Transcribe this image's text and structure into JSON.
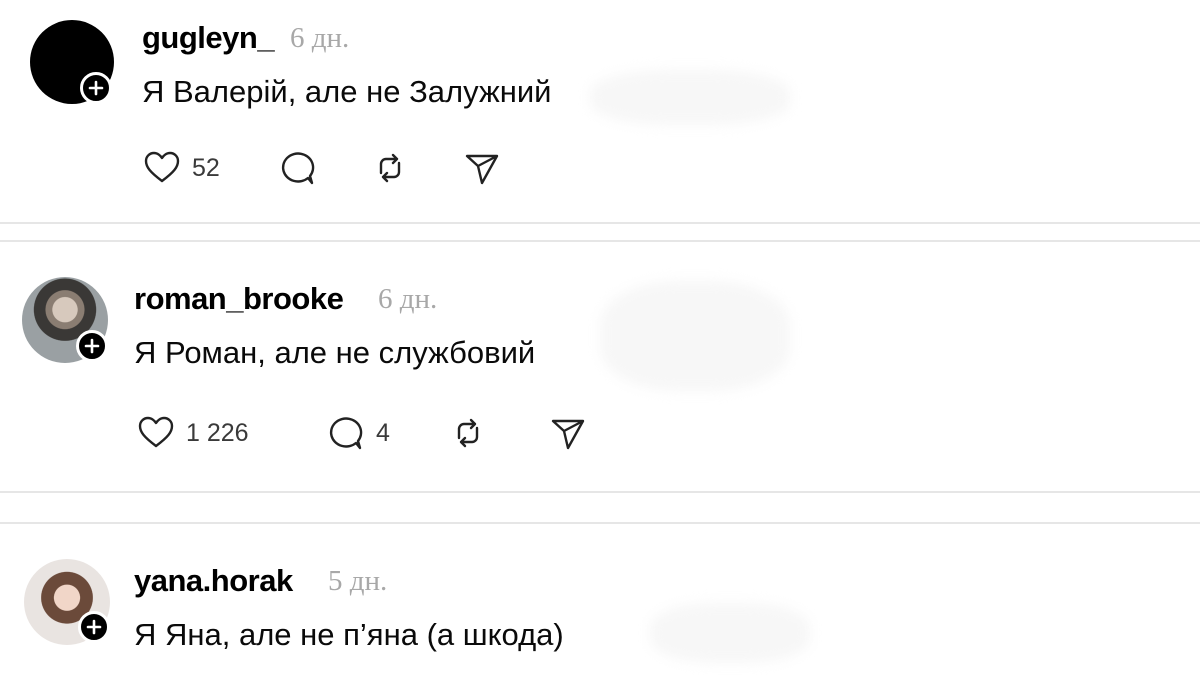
{
  "posts": [
    {
      "username": "gugleyn_",
      "time": "6 дн.",
      "text": "Я Валерій, але не Залужний",
      "likes": "52",
      "replies": "",
      "avatar_icon": "black-circle-avatar",
      "icons": [
        "heart-icon",
        "comment-icon",
        "repost-icon",
        "share-icon"
      ]
    },
    {
      "username": "roman_brooke",
      "time": "6 дн.",
      "text": "Я Роман, але не службовий",
      "likes": "1 226",
      "replies": "4",
      "avatar_icon": "person-photo-avatar",
      "icons": [
        "heart-icon",
        "comment-icon",
        "repost-icon",
        "share-icon"
      ]
    },
    {
      "username": "yana.horak",
      "time": "5 дн.",
      "text": "Я Яна, але не п’яна (а шкода)",
      "avatar_icon": "person-photo-avatar"
    }
  ],
  "colors": {
    "text": "#0a0a0a",
    "muted": "#a8a8a8",
    "divider": "#e6e6e6",
    "badge": "#000000"
  }
}
